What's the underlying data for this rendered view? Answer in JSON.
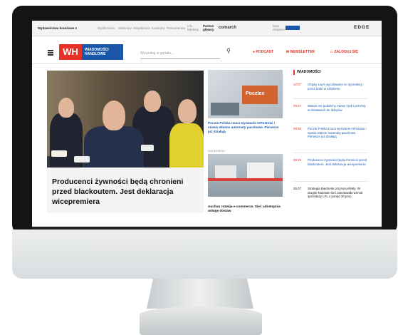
{
  "topbar": {
    "publisher": "Wydawnictwa branżowe ▾",
    "links": [
      "Wydarzenia",
      "Webinary",
      "Współpraca",
      "Konkursy",
      "Prenumerata",
      "Info Markety"
    ],
    "partner_label": "Partner główny",
    "partner_name": "comarch",
    "extra_label": "Nasi eksperci",
    "edge": "EDGE"
  },
  "header": {
    "logo_short": "WH",
    "logo_full": "WIADOMOŚCI HANDLOWE",
    "search_placeholder": "Wyszukaj w portalu...",
    "podcast": "PODCAST",
    "newsletter": "NEWSLETTER",
    "login": "ZALOGUJ SIĘ",
    "colors": {
      "accent": "#e63225",
      "brand_blue": "#1b57a8"
    }
  },
  "hero": {
    "title": "Producenci żywności będą chronieni przed blackoutem. Jest deklaracja wicepremiera"
  },
  "middle": {
    "thumb_sign": "Pocztex",
    "article1": "Poczta Polska rzuca wyzwanie InPostowi i stawia własne automaty paczkowe. Pierwsze już działają",
    "tag": "DLA BIZNESU",
    "article2": "Auchan rozwija e-commerce. Sieć udostępnia usługę dostaw"
  },
  "sidebar": {
    "heading": "WIADOMOŚCI",
    "items": [
      {
        "time": "10:07",
        "text": "Chipsy Lay's wycofywane ze sprzedaży przez braki w szkoleniu"
      },
      {
        "time": "09:27",
        "text": "Wasze ma problemy. Nowy zysk i przerwy w dostawach do sklepów"
      },
      {
        "time": "08:55",
        "text": "Poczta Polska rzuca wyzwanie InPostowi i stawia własne automaty paczkowe. Pierwsze już działają"
      },
      {
        "time": "08:29",
        "text": "Producenci żywności będą chronieni przed blackoutem. Jest deklaracja wicepremiera"
      },
      {
        "time": "26.07",
        "text": "Strategia Biedronki przynosi efekty. W drugim kwartale sieć zanotowała wzrost sprzedaży LFL o ponad 20 proc."
      }
    ]
  }
}
